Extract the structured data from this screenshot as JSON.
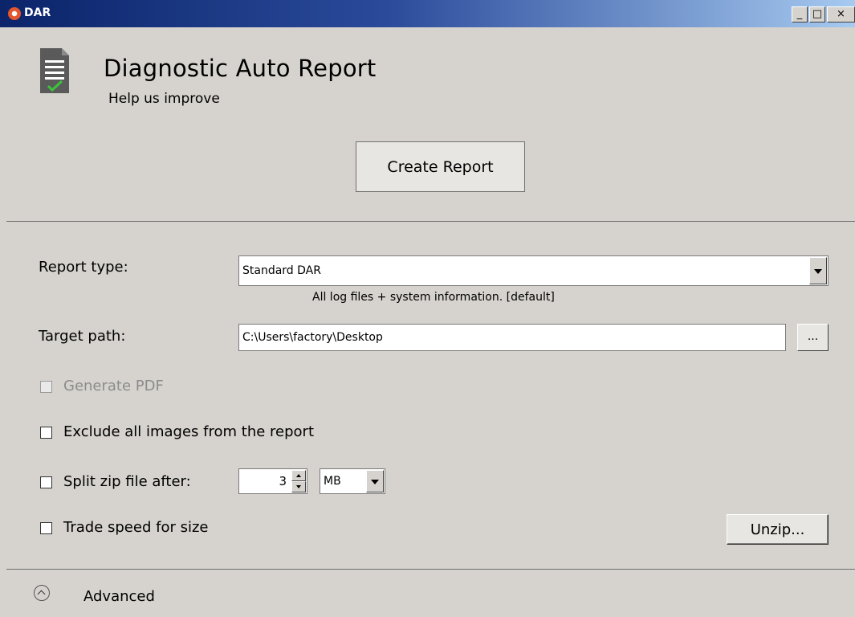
{
  "window": {
    "title": "DAR",
    "minimize": "_",
    "maximize": "□",
    "close": "×"
  },
  "header": {
    "title": "Diagnostic Auto Report",
    "subtitle": "Help us improve",
    "icon": "document-check-icon"
  },
  "create_button": "Create Report",
  "form": {
    "report_type_label": "Report type:",
    "report_type_value": "Standard DAR",
    "report_type_hint": "All log files + system information. [default]",
    "target_path_label": "Target path:",
    "target_path_value": "C:\\Users\\factory\\Desktop",
    "browse_label": "...",
    "generate_pdf_label": "Generate PDF",
    "exclude_images_label": "Exclude all images from the report",
    "split_zip_label": "Split zip file after:",
    "split_size_value": "3",
    "split_unit": "MB",
    "trade_speed_label": "Trade speed for size",
    "unzip_label": "Unzip..."
  },
  "footer": {
    "advanced_label": "Advanced"
  }
}
